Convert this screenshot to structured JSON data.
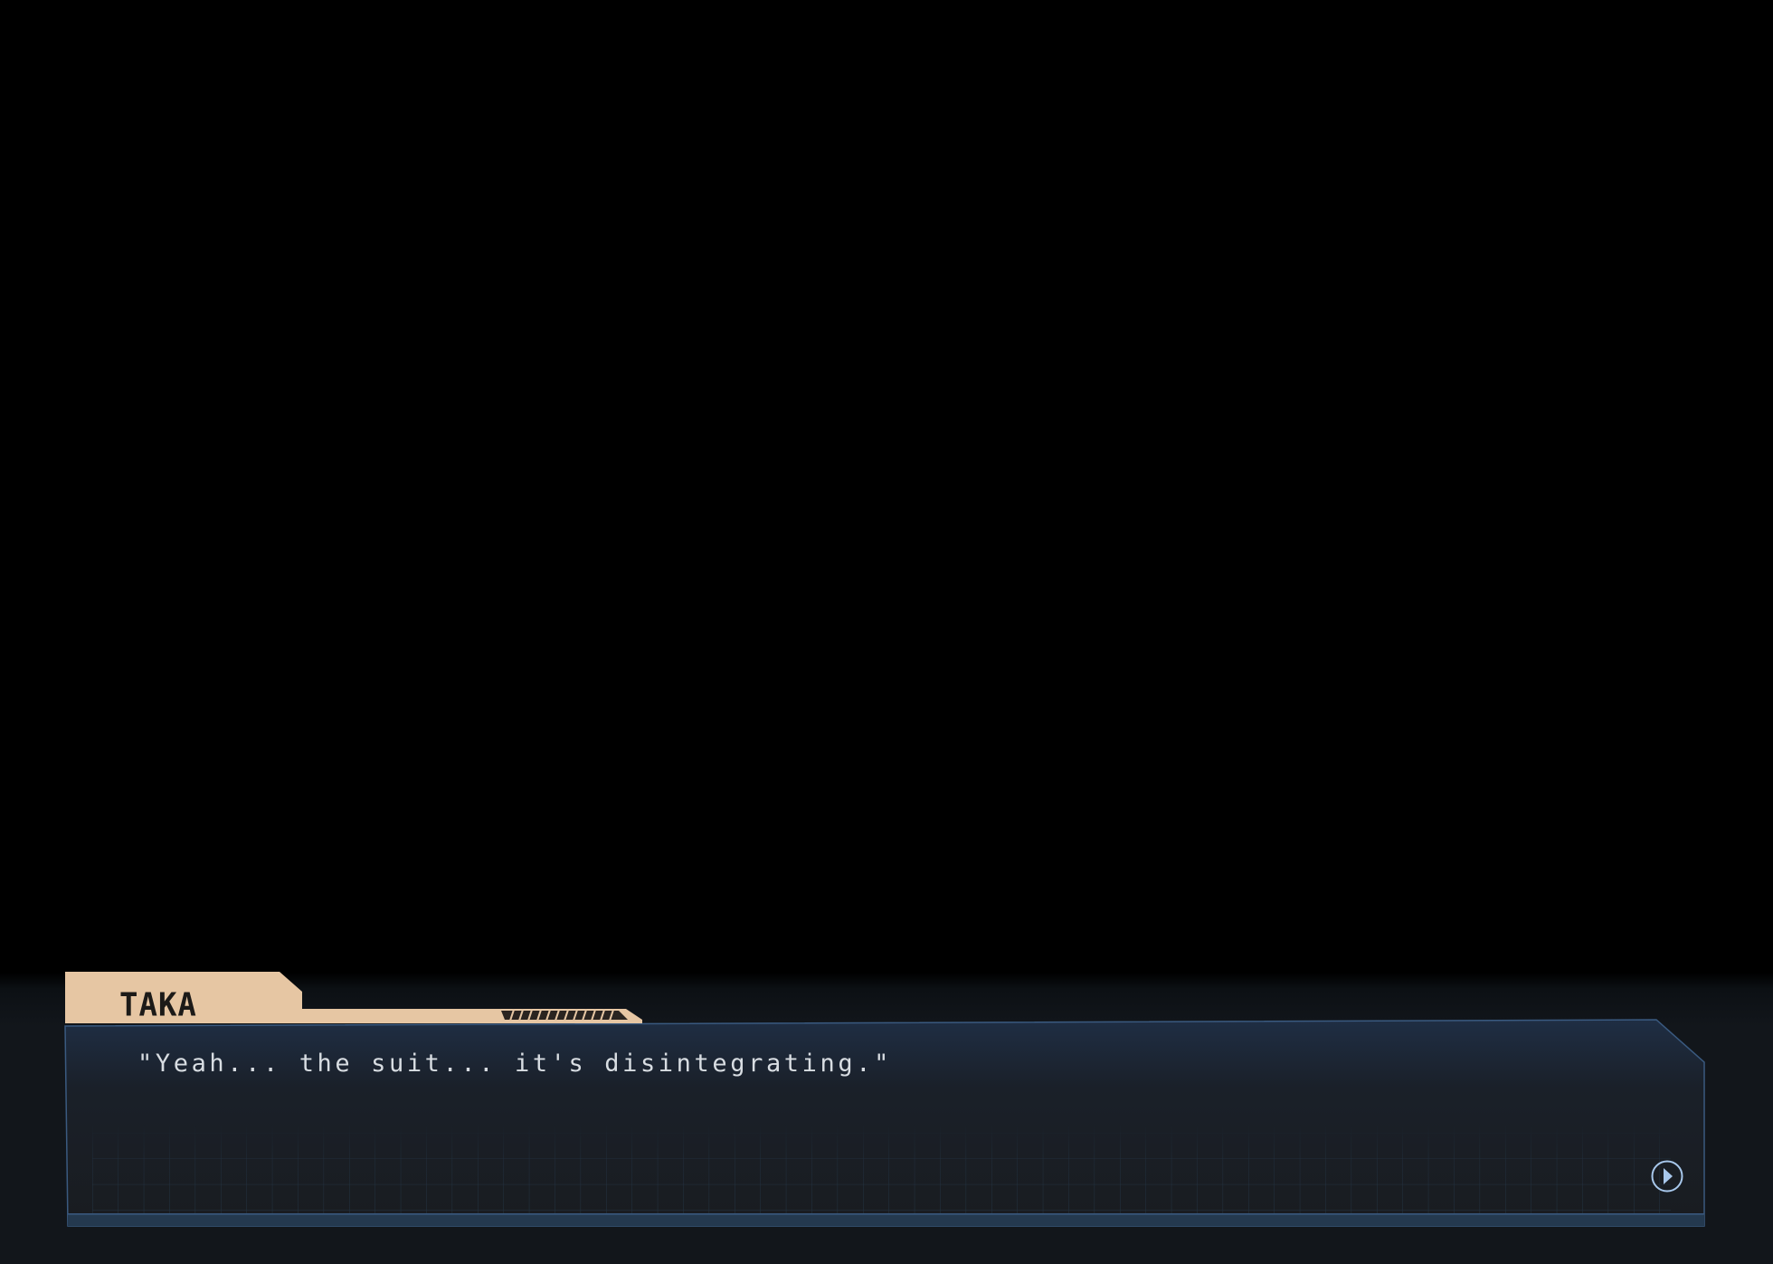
{
  "dialogue": {
    "speaker": "TAKA",
    "line": "\"Yeah... the suit... it's disintegrating.\""
  },
  "icons": {
    "advance": "play-circle-icon"
  },
  "colors": {
    "name_tab": "#e6c6a3",
    "panel_top": "#1d2b40",
    "panel_bottom": "#1a1e23",
    "panel_border": "#3a5a80",
    "text": "#d8dde2",
    "accent": "#a8c8ec"
  }
}
